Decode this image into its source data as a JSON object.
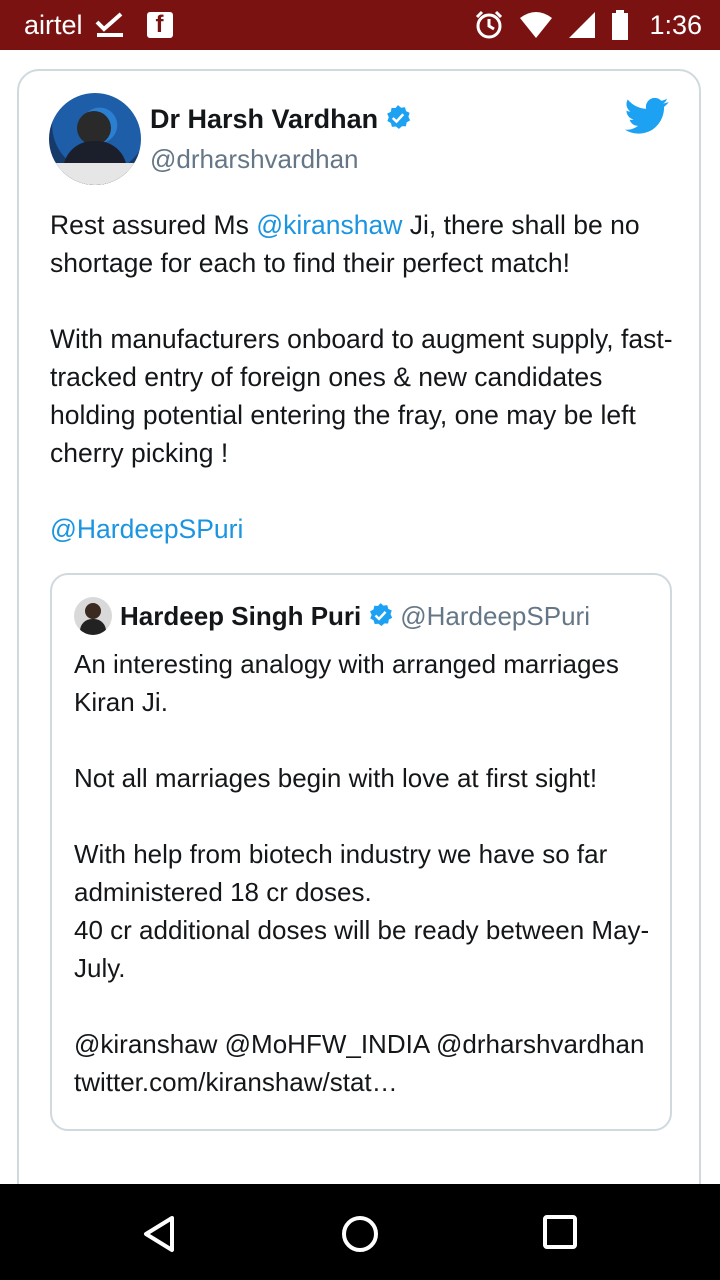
{
  "status_bar": {
    "carrier": "airtel",
    "time": "1:36"
  },
  "tweet": {
    "display_name": "Dr Harsh Vardhan",
    "handle": "@drharshvardhan",
    "paragraph1_pre": "Rest assured Ms ",
    "paragraph1_mention": "@kiranshaw",
    "paragraph1_post": " Ji, there shall be no shortage for each to find their perfect match!",
    "paragraph2": "With manufacturers onboard to augment supply, fast-tracked entry of foreign ones & new candidates holding potential entering the fray, one may be left cherry picking !",
    "mention_line": "@HardeepSPuri"
  },
  "quoted_tweet": {
    "display_name": "Hardeep Singh Puri",
    "handle": "@HardeepSPuri",
    "line1": "An interesting analogy with arranged marriages Kiran Ji.",
    "line2": "Not all marriages begin with love at first sight!",
    "line3": "With help from biotech industry we have so far administered 18 cr doses.",
    "line4": "40 cr additional doses will be ready between May-July.",
    "line5": "@kiranshaw @MoHFW_INDIA @drharshvardhan",
    "line6": "twitter.com/kiranshaw/stat…"
  },
  "colors": {
    "status_bar": "#7a1212",
    "twitter_blue": "#1da1f2",
    "mention_blue": "#1b95e0",
    "border": "#cfd9de"
  },
  "icons": [
    "check-icon",
    "facebook-icon",
    "alarm-icon",
    "wifi-icon",
    "signal-icon",
    "battery-icon",
    "verified-icon",
    "twitter-bird-icon",
    "back-icon",
    "home-icon",
    "recents-icon"
  ]
}
